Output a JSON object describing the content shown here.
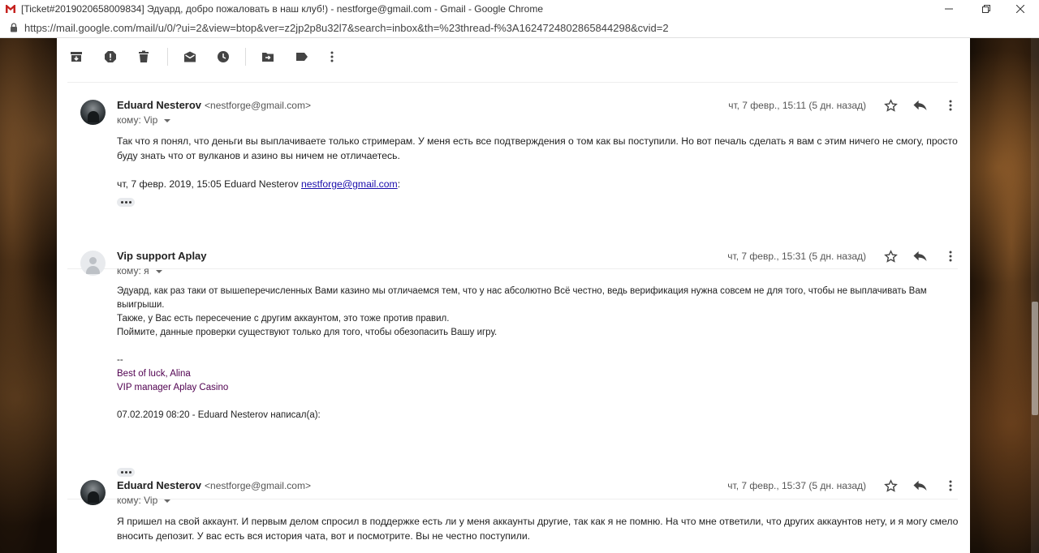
{
  "window": {
    "title": "[Ticket#2019020658009834] Эдуард, добро пожаловать в наш клуб!) - nestforge@gmail.com - Gmail - Google Chrome",
    "minimize": "—",
    "maximize": "❐",
    "close": "✕"
  },
  "address": {
    "url": "https://mail.google.com/mail/u/0/?ui=2&view=btop&ver=z2jp2p8u32l7&search=inbox&th=%23thread-f%3A1624724802865844298&cvid=2"
  },
  "toolbar": {
    "buttons": [
      "archive-icon",
      "report-spam-icon",
      "delete-icon",
      "mark-unread-icon",
      "snooze-icon",
      "move-to-icon",
      "label-icon",
      "more-vert-icon"
    ]
  },
  "messages": [
    {
      "sender_name": "Eduard Nesterov",
      "sender_email": "<nestforge@gmail.com>",
      "to": "кому: Vip",
      "date": "чт, 7 февр., 15:11 (5 дн. назад)",
      "body_line1": "Так что я понял, что деньги вы выплачиваете только стримерам. У меня есть все подтверждения о том как вы поступили. Но вот печаль сделать я вам с этим ничего не смогу, просто",
      "body_line2": "буду знать что от вулканов и азино вы ничем не отличаетесь.",
      "quote_prefix": "чт, 7 февр. 2019, 15:05 Eduard Nesterov ",
      "quote_link": "nestforge@gmail.com",
      "quote_suffix": ":"
    },
    {
      "sender_name": "Vip support Aplay",
      "to": "кому: я",
      "date": "чт, 7 февр., 15:31 (5 дн. назад)",
      "body_line1": " Эдуард, как раз таки от вышеперечисленных Вами казино мы отличаемся тем, что у нас абсолютно Всё честно, ведь верификация нужна совсем не для того, чтобы не выплачивать Вам",
      "body_line2": "выигрыши.",
      "body_line3": " Также, у Вас есть пересечение с другим аккаунтом, это тоже против правил.",
      "body_line4": "Поймите, данные проверки существуют только для того, чтобы обезопасить Вашу игру.",
      "sig_dash": "--",
      "sig_line1": "Best of luck, Alina",
      "sig_line2": "VIP manager Aplay Casino",
      "quote": "07.02.2019 08:20 - Eduard Nesterov написал(а):"
    },
    {
      "sender_name": "Eduard Nesterov",
      "sender_email": "<nestforge@gmail.com>",
      "to": "кому: Vip",
      "date": "чт, 7 февр., 15:37 (5 дн. назад)",
      "body_line1": "Я пришел на свой аккаунт. И первым делом спросил в поддержке есть ли у меня аккаунты другие, так как я не помню. На что мне ответили, что других аккаунтов нету, и я могу смело",
      "body_line2": "вносить депозит. У вас есть вся история чата, вот и посмотрите. Вы не честно поступили."
    }
  ]
}
